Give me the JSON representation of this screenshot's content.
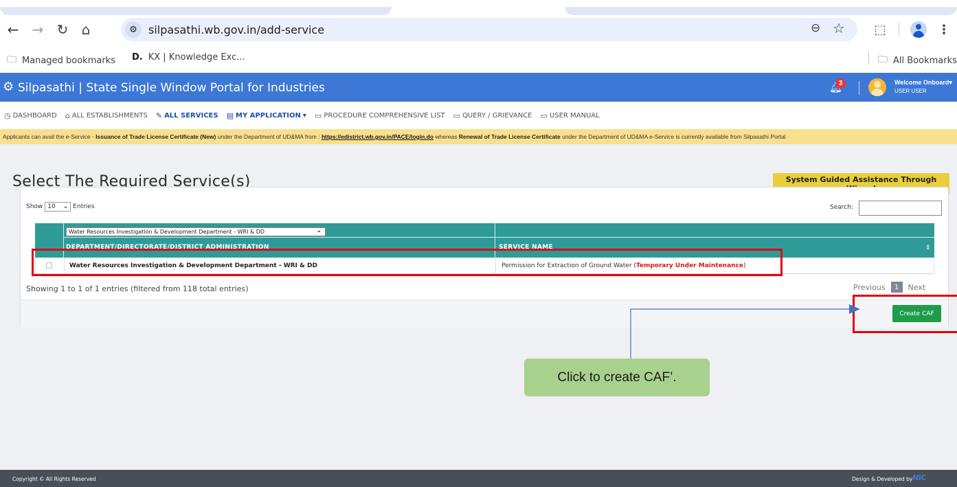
{
  "browser": {
    "url": "silpasathi.wb.gov.in/add-service",
    "icons": {
      "back": "back-arrow-icon",
      "forward": "forward-arrow-icon",
      "reload": "reload-icon",
      "home": "home-icon",
      "tune": "site-info-icon",
      "zoom": "zoom-icon",
      "star": "bookmark-star-icon",
      "extensions": "extensions-icon",
      "profile": "profile-icon",
      "menu": "kebab-menu-icon"
    }
  },
  "bookmarks": {
    "managed": "Managed bookmarks",
    "kx_mark": "D.",
    "kx": "KX | Knowledge Exc...",
    "all": "All Bookmarks"
  },
  "header": {
    "title": "Silpasathi | State Single Window Portal for Industries",
    "notification_count": "3",
    "welcome": "Welcome Onboard",
    "user": "USER USER",
    "bg_color": "#3d78d6"
  },
  "menu": {
    "items": [
      {
        "label": "DASHBOARD",
        "icon": "dashboard-icon"
      },
      {
        "label": "ALL ESTABLISHMENTS",
        "icon": "building-icon"
      },
      {
        "label": "ALL SERVICES",
        "icon": "wrench-icon"
      },
      {
        "label": "MY APPLICATION",
        "icon": "document-icon"
      },
      {
        "label": "PROCEDURE COMPREHENSIVE LIST",
        "icon": "list-icon"
      },
      {
        "label": "QUERY / GRIEVANCE",
        "icon": "list-icon"
      },
      {
        "label": "USER MANUAL",
        "icon": "list-icon"
      }
    ]
  },
  "notice": {
    "t1": "Applicants can avail the e-Service - ",
    "b1": "Issuance of Trade License Certificate (New)",
    "t2": " under the Department of UD&MA from : ",
    "link": "https://edistrict.wb.gov.in/PACE/login.do",
    "t3": " whereas ",
    "b2": "Renewal of Trade License Certificate",
    "t4": " under the Department of UD&MA e-Service is currently available from Silpasathi Portal"
  },
  "page": {
    "title": "Select The Required Service(s)",
    "wizard_button": "System Guided Assistance Through Wizard",
    "show": "Show",
    "show_value": "10",
    "entries": "Entries",
    "search_label": "Search:",
    "filter_value": "Water Resources Investigation & Development Department - WRI & DD",
    "col_department": "DEPARTMENT/DIRECTORATE/DISTRICT ADMINISTRATION",
    "col_service": "SERVICE NAME",
    "rows": [
      {
        "department": "Water Resources Investigation & Development Department - WRI & DD",
        "service": "Permission for Extraction of Ground Water (",
        "service_status": "Temporary Under Maintenance",
        "service_close": ")"
      }
    ],
    "showing": "Showing 1 to 1 of 1 entries (filtered from 118 total entries)",
    "previous": "Previous",
    "page_num": "1",
    "next": "Next",
    "create_button": "Create CAF"
  },
  "annotation": {
    "callout": "Click to create CAF’.",
    "box_color": "#e3000f",
    "callout_color": "#a9d18e"
  },
  "footer": {
    "copyright": "Copyright © All Rights Reserved",
    "credit": "Design & Developed by",
    "nic": "NIC"
  }
}
